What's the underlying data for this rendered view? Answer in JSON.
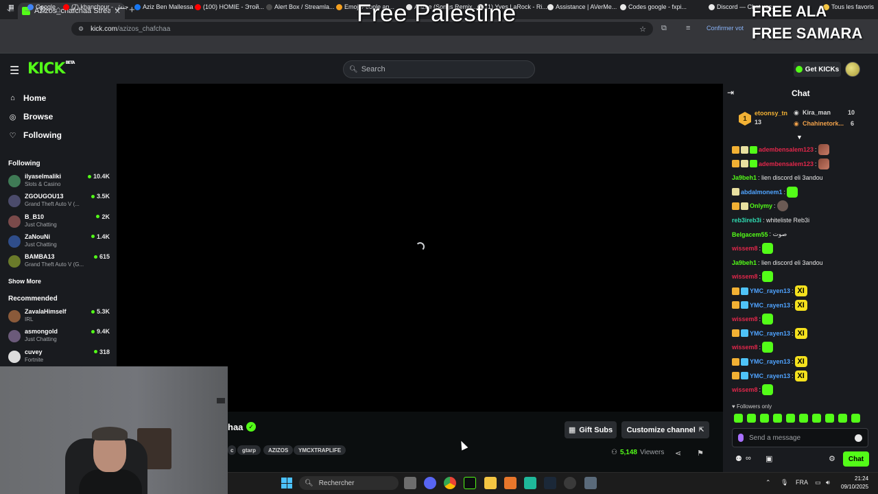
{
  "browser": {
    "tab_title": "Azizos_chafchaa Stream - Watch",
    "url_host": "kick.com",
    "url_path": "/azizos_chafchaa",
    "confirm_text": "Confirmer vot",
    "bookmarks": [
      "Google",
      "(7) khanchour - جنش",
      "Aziz Ben Mallessa",
      "(100) HOMIE - Этой...",
      "Alert Box / Streamla...",
      "Emoji People an...",
      "Ahzee (Songs Remix...",
      "(1) Yves LaRock - Ri...",
      "Assistance | AVerMe...",
      "Codes google - fxpi...",
      "Discord — Chat voc...",
      "Tous les favoris"
    ]
  },
  "overlay": {
    "center_text": "Free Palestine",
    "right_line1": "FREE ALA",
    "right_line2": "FREE SAMARA"
  },
  "header": {
    "logo": "KICK",
    "logo_beta": "BETA",
    "search_placeholder": "Search",
    "get_kicks_label": "Get KICKs"
  },
  "sidebar": {
    "nav": [
      {
        "label": "Home",
        "icon": "home-icon"
      },
      {
        "label": "Browse",
        "icon": "compass-icon"
      },
      {
        "label": "Following",
        "icon": "heart-icon"
      }
    ],
    "following_title": "Following",
    "following": [
      {
        "name": "ilyaselmaliki",
        "category": "Slots & Casino",
        "viewers": "10.4K",
        "color": "#3f7a55"
      },
      {
        "name": "ZGOUGOU13",
        "category": "Grand Theft Auto V (...",
        "viewers": "3.5K",
        "color": "#4b4b6b"
      },
      {
        "name": "B_B10",
        "category": "Just Chatting",
        "viewers": "2K",
        "color": "#7a4a4a"
      },
      {
        "name": "ZaNouNi",
        "category": "Just Chatting",
        "viewers": "1.4K",
        "color": "#2f4d8a"
      },
      {
        "name": "BAMBA13",
        "category": "Grand Theft Auto V (G...",
        "viewers": "615",
        "color": "#6a7a2a"
      }
    ],
    "show_more": "Show More",
    "recommended_title": "Recommended",
    "recommended": [
      {
        "name": "ZavalaHimself",
        "category": "IRL",
        "viewers": "5.3K",
        "color": "#8a5a3a"
      },
      {
        "name": "asmongold",
        "category": "Just Chatting",
        "viewers": "9.4K",
        "color": "#6b5a7a"
      },
      {
        "name": "cuvey",
        "category": "Fortnite",
        "viewers": "318",
        "color": "#dcdcdc"
      }
    ]
  },
  "stream": {
    "channel_name_partial": "haa",
    "tags": [
      "c",
      "gtarp",
      "AZIZOS",
      "YMCXTRAPLIFE"
    ],
    "gift_subs": "Gift Subs",
    "customize": "Customize channel",
    "viewers_count": "5,148",
    "viewers_label": "Viewers"
  },
  "chat": {
    "title": "Chat",
    "top_gifters": {
      "rank": "1",
      "first": {
        "name": "etoonsy_tn",
        "count": "13"
      },
      "second": {
        "name": "Kira_man",
        "count": "10"
      },
      "third": {
        "name": "Chahinetork...",
        "count": "6"
      }
    },
    "messages": [
      {
        "user": "adembensalem123",
        "color": "#e0274a",
        "text": ":",
        "badges": [
          "#f2b134",
          "#e8e0a0",
          "#53fc18"
        ],
        "emote": "kappa"
      },
      {
        "user": "adembensalem123",
        "color": "#e0274a",
        "text": ":",
        "badges": [
          "#f2b134",
          "#e8e0a0",
          "#53fc18"
        ],
        "emote": "kappa"
      },
      {
        "user": "Ja9beh1",
        "color": "#53fc18",
        "text": ": lien discord eli 3andou",
        "badges": [],
        "emote": ""
      },
      {
        "user": "abdalmonem1",
        "color": "#4fa3ff",
        "text": ":",
        "badges": [
          "#e8e0a0"
        ],
        "emote": "green"
      },
      {
        "user": "Onlymy",
        "color": "#53fc18",
        "text": ":",
        "badges": [
          "#f2b134",
          "#e8e0a0"
        ],
        "emote": "cat"
      },
      {
        "user": "reb3ireb3i",
        "color": "#2fd9b0",
        "text": ": whiteliste Reb3i",
        "badges": [],
        "emote": ""
      },
      {
        "user": "Belgacem55",
        "color": "#53fc18",
        "text": ": صوت",
        "badges": [],
        "emote": ""
      },
      {
        "user": "wissem8",
        "color": "#e0274a",
        "text": ":",
        "badges": [],
        "emote": "green"
      },
      {
        "user": "Ja9beh1",
        "color": "#53fc18",
        "text": ": lien discord eli 3andou",
        "badges": [],
        "emote": ""
      },
      {
        "user": "wissem8",
        "color": "#e0274a",
        "text": ":",
        "badges": [],
        "emote": "green"
      },
      {
        "user": "YMC_rayen13",
        "color": "#4fa3ff",
        "text": ":",
        "badges": [
          "#f2b134",
          "#4fc3f7"
        ],
        "emote": "x"
      },
      {
        "user": "YMC_rayen13",
        "color": "#4fa3ff",
        "text": ":",
        "badges": [
          "#f2b134",
          "#4fc3f7"
        ],
        "emote": "x"
      },
      {
        "user": "wissem8",
        "color": "#e0274a",
        "text": ":",
        "badges": [],
        "emote": "green"
      },
      {
        "user": "YMC_rayen13",
        "color": "#4fa3ff",
        "text": ":",
        "badges": [
          "#f2b134",
          "#4fc3f7"
        ],
        "emote": "x"
      },
      {
        "user": "wissem8",
        "color": "#e0274a",
        "text": ":",
        "badges": [],
        "emote": "green"
      },
      {
        "user": "YMC_rayen13",
        "color": "#4fa3ff",
        "text": ":",
        "badges": [
          "#f2b134",
          "#4fc3f7"
        ],
        "emote": "x"
      },
      {
        "user": "YMC_rayen13",
        "color": "#4fa3ff",
        "text": ":",
        "badges": [
          "#f2b134",
          "#4fc3f7"
        ],
        "emote": "x"
      },
      {
        "user": "wissem8",
        "color": "#e0274a",
        "text": ":",
        "badges": [],
        "emote": "green"
      }
    ],
    "followers_only": "Followers only",
    "input_placeholder": "Send a message",
    "send_label": "Chat"
  },
  "taskbar": {
    "search_placeholder": "Rechercher",
    "language": "FRA",
    "time": "21:24",
    "date": "09/10/2025"
  },
  "colors": {
    "accent": "#53fc18",
    "background": "#0b0e0f",
    "panel": "#191b1f"
  }
}
